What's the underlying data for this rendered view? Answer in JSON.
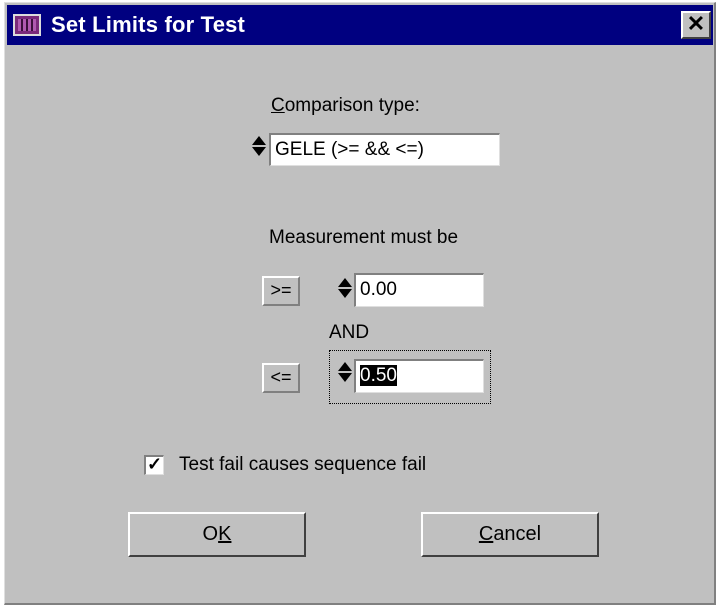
{
  "window": {
    "title": "Set Limits for Test",
    "close_glyph": "✕"
  },
  "comparison": {
    "label_prefix": "",
    "label_hotkey": "C",
    "label_rest": "omparison type:",
    "value": "GELE (>= && <=)"
  },
  "measurement": {
    "label": "Measurement must be",
    "low": {
      "operator": ">=",
      "value": "0.00"
    },
    "conjunction": "AND",
    "high": {
      "operator": "<=",
      "value": "0.50"
    }
  },
  "options": {
    "fail_checkbox": {
      "checked": true,
      "check_glyph": "✓",
      "label": "Test fail causes sequence fail"
    }
  },
  "buttons": {
    "ok": {
      "prefix": "O",
      "hotkey": "K"
    },
    "cancel": {
      "hotkey": "C",
      "rest": "ancel"
    }
  },
  "icons": {
    "spinner": "spinner-icon",
    "app": "app-icon",
    "close": "close-icon"
  }
}
